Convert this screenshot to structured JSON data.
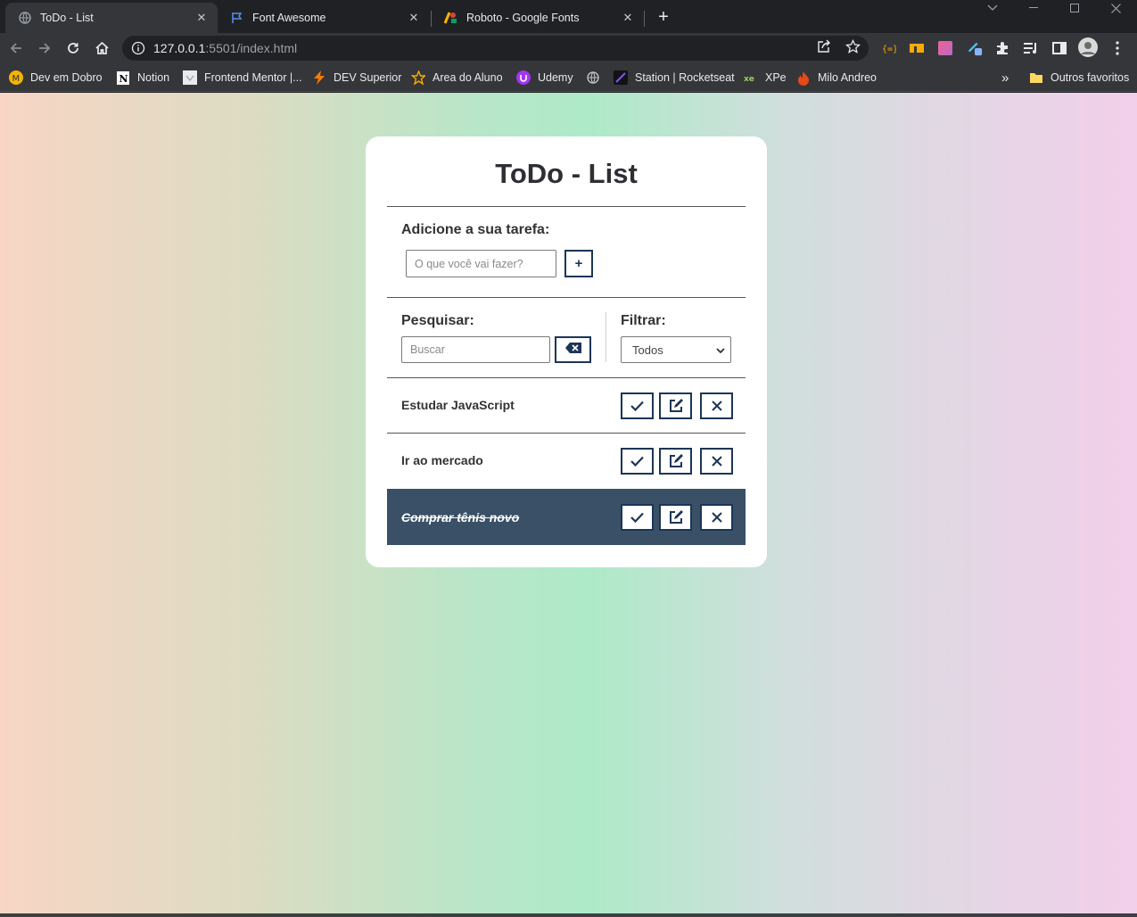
{
  "browser": {
    "tabs": [
      {
        "title": "ToDo - List",
        "icon": "globe-icon",
        "active": true
      },
      {
        "title": "Font Awesome",
        "icon": "flag-icon",
        "active": false
      },
      {
        "title": "Roboto - Google Fonts",
        "icon": "google-fonts-icon",
        "active": false
      }
    ],
    "url_host": "127.0.0.1",
    "url_rest": ":5501/index.html",
    "bookmarks": [
      {
        "label": "Dev em Dobro",
        "icon": "dev-em-dobro-icon"
      },
      {
        "label": "Notion",
        "icon": "notion-icon"
      },
      {
        "label": "Frontend Mentor |...",
        "icon": "frontend-mentor-icon"
      },
      {
        "label": "DEV Superior",
        "icon": "lightning-icon"
      },
      {
        "label": "Area do Aluno",
        "icon": "star-icon"
      },
      {
        "label": "Udemy",
        "icon": "udemy-icon"
      },
      {
        "label": "Station | Rocketseat",
        "icon": "rocketseat-icon"
      },
      {
        "label": "XPe",
        "icon": "xpe-icon"
      },
      {
        "label": "Milo Andreo",
        "icon": "flame-icon"
      }
    ],
    "other_bookmarks": "Outros favoritos",
    "overflow_label": "»"
  },
  "app": {
    "title": "ToDo - List",
    "add_label": "Adicione a sua tarefa:",
    "add_placeholder": "O que você vai fazer?",
    "add_button": "+",
    "search_label": "Pesquisar:",
    "search_placeholder": "Buscar",
    "filter_label": "Filtrar:",
    "filter_selected": "Todos",
    "todos": [
      {
        "text": "Estudar JavaScript",
        "done": false
      },
      {
        "text": "Ir ao mercado",
        "done": false
      },
      {
        "text": "Comprar tênis novo",
        "done": true
      }
    ]
  },
  "colors": {
    "accent": "#1d3557",
    "done_row": "#395066"
  }
}
